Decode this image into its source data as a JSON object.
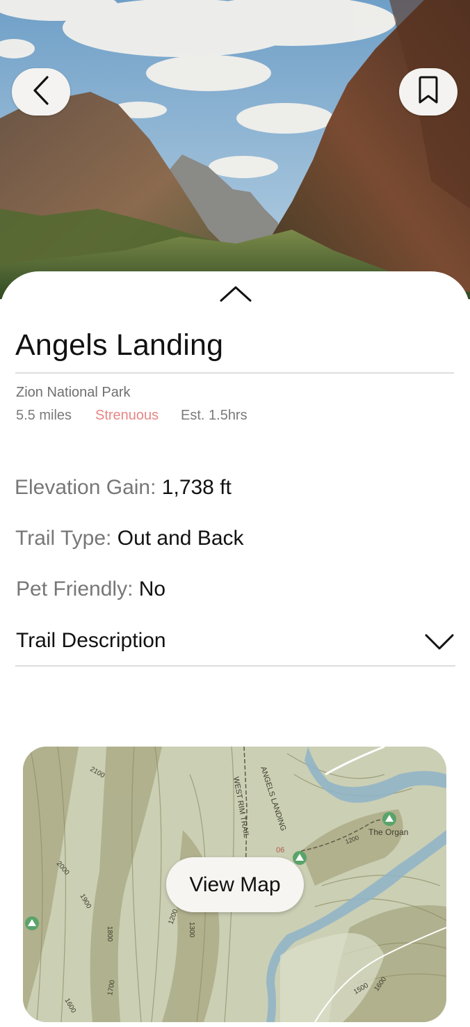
{
  "hero": {
    "image": "zion-canyon-photo"
  },
  "header": {
    "back_icon": "chevron-left-icon",
    "bookmark_icon": "bookmark-icon"
  },
  "sheet": {
    "collapse_icon": "chevron-up-icon"
  },
  "trail": {
    "name": "Angels Landing",
    "park": "Zion National Park",
    "distance": "5.5 miles",
    "difficulty": "Strenuous",
    "duration": "Est. 1.5hrs",
    "difficulty_color": "#e98585"
  },
  "details": {
    "elevation_label": "Elevation Gain:",
    "elevation_value": "1,738 ft",
    "type_label": "Trail Type:",
    "type_value": "Out and Back",
    "pet_label": "Pet Friendly:",
    "pet_value": "No"
  },
  "description": {
    "label": "Trail Description",
    "expand_icon": "chevron-down-icon"
  },
  "map": {
    "button": "View Map",
    "labels": {
      "west_rim": "WEST RIM TRAIL",
      "angels_landing": "ANGELS LANDING",
      "the_organ": "The Organ",
      "c2100": "2100",
      "c2000": "2000",
      "c1900": "1900",
      "c1800": "1800",
      "c1700": "1700",
      "c1600": "1600",
      "c1200a": "1200",
      "c1200b": "1200",
      "c1300": "1300",
      "c1500": "1500",
      "c1600b": "1600",
      "tag06": "06"
    }
  }
}
